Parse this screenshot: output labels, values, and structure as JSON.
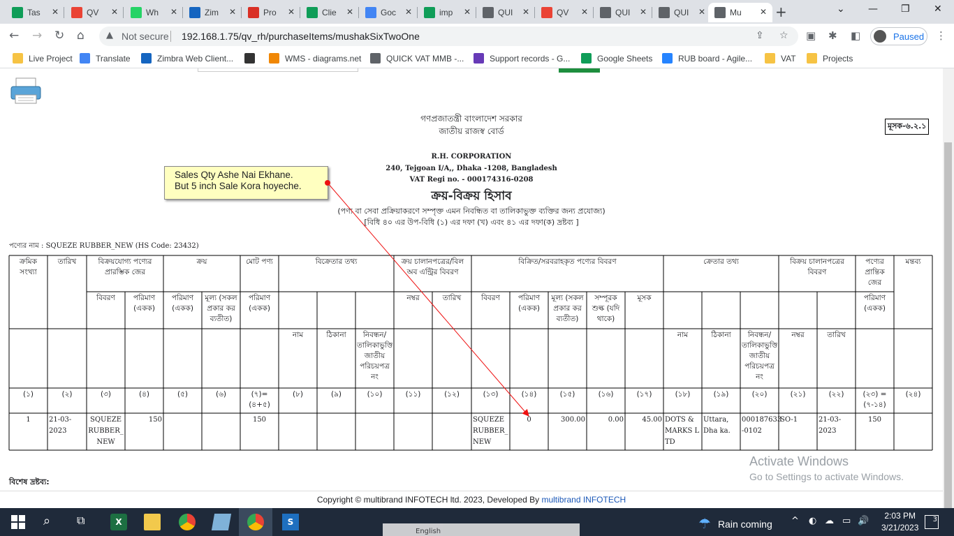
{
  "browser": {
    "tabs": [
      {
        "title": "Tas",
        "icon": "google-sheets-icon",
        "color": "#0f9d58"
      },
      {
        "title": "QV",
        "icon": "chrome-icon",
        "color": "#ea4335"
      },
      {
        "title": "Wh",
        "icon": "whatsapp-icon",
        "color": "#25d366"
      },
      {
        "title": "Zim",
        "icon": "zimbra-icon",
        "color": "#1565c0"
      },
      {
        "title": "Pro",
        "icon": "gmail-icon",
        "color": "#d93025"
      },
      {
        "title": "Clie",
        "icon": "google-sheets-icon",
        "color": "#0f9d58"
      },
      {
        "title": "Goc",
        "icon": "google-calendar-icon",
        "color": "#4285f4"
      },
      {
        "title": "imp",
        "icon": "google-sheets-icon",
        "color": "#0f9d58"
      },
      {
        "title": "QUI",
        "icon": "gear-icon",
        "color": "#5f6368"
      },
      {
        "title": "QV",
        "icon": "chrome-icon",
        "color": "#ea4335"
      },
      {
        "title": "QUI",
        "icon": "gear-icon",
        "color": "#5f6368"
      },
      {
        "title": "QUI",
        "icon": "gear-icon",
        "color": "#5f6368"
      },
      {
        "title": "Mu",
        "icon": "gear-icon",
        "color": "#5f6368",
        "active": true
      }
    ],
    "not_secure": "Not secure",
    "url": "192.168.1.75/qv_rh/purchaseItems/mushakSixTwoOne",
    "profile": "Paused",
    "bookmarks": [
      {
        "label": "Live Project",
        "color": "#f6c344"
      },
      {
        "label": "Translate",
        "color": "#4285f4"
      },
      {
        "label": "Zimbra Web Client...",
        "color": "#1565c0"
      },
      {
        "label": "",
        "color": "#333"
      },
      {
        "label": "WMS - diagrams.net",
        "color": "#f08705"
      },
      {
        "label": "QUICK VAT MMB -...",
        "color": "#5f6368"
      },
      {
        "label": "Support records - G...",
        "color": "#673ab7"
      },
      {
        "label": "Google Sheets",
        "color": "#0f9d58"
      },
      {
        "label": "RUB board - Agile...",
        "color": "#2684ff"
      },
      {
        "label": "VAT",
        "color": "#f6c344"
      },
      {
        "label": "Projects",
        "color": "#f6c344"
      }
    ]
  },
  "report": {
    "govt": "গণপ্রজাতন্ত্রী বাংলাদেশ সরকার",
    "board": "জাতীয় রাজস্ব বোর্ড",
    "form_code": "মূসক-৬.২.১",
    "company": "R.H. CORPORATION",
    "address": "240, Tejgoan I/A,, Dhaka -1208, Bangladesh",
    "vat_reg": "VAT Regi no. - 000174316-0208",
    "title": "ক্রয়-বিক্রয় হিসাব",
    "subtitle": "(পণ্য বা সেবা প্রক্রিয়াকরণে সম্পৃক্ত এমন নিবন্ধিত বা তালিকাভুক্ত ব্যক্তির জন্য প্রযোজ্য)",
    "rule": "[বিধি ৪০ এর উপ-বিধি (১) এর দফা (খ) এবং ৪১ এর দফা(ক) দ্রষ্টব্য ]",
    "product_line": "পণ্যের নাম : SQUEZE RUBBER_NEW (HS Code: 23432)",
    "note_line1": "Sales Qty Ashe Nai Ekhane.",
    "note_line2": "But 5 inch Sale Kora hoyeche.",
    "headers": {
      "serial": "ক্রমিক সংখ্যা",
      "date": "তারিখ",
      "opening": "বিক্রয়যোগ্য পণ্যের প্রারম্ভিক জের",
      "purchase": "ক্রয়",
      "total": "মোট পণ্য",
      "seller_info": "বিক্রেতার তথ্য",
      "purchase_invoice": "ক্রয় চালানপত্রের/বিল অব এন্ট্রির বিবরণ",
      "sold_goods": "বিক্রিত/সরবরাহকৃত পণ্যের বিবরণ",
      "buyer_info": "ক্রেতার তথ্য",
      "sales_invoice": "বিক্রয় চালানপত্রের বিবরণ",
      "closing": "পণ্যের প্রান্তিক জের",
      "remarks": "মন্তব্য",
      "desc": "বিবরণ",
      "qty": "পরিমাণ (একক)",
      "price": "মূল্য (সকল প্রকার কর ব্যতীত)",
      "sd": "সম্পূরক শুল্ক (যদি থাকে)",
      "vat": "মূসক",
      "number": "নম্বর",
      "name": "নাম",
      "address": "ঠিকানা",
      "reg": "নিবন্ধন/ তালিকাভুক্তি জাতীয় পরিচয়পত্র নং"
    },
    "col_numbers": [
      "(১)",
      "(২)",
      "(৩)",
      "(৪)",
      "(৫)",
      "(৬)",
      "(৭)=(৪+৫)",
      "(৮)",
      "(৯)",
      "(১০)",
      "(১১)",
      "(১২)",
      "(১৩)",
      "(১৪)",
      "(১৫)",
      "(১৬)",
      "(১৭)",
      "(১৮)",
      "(১৯)",
      "(২০)",
      "(২১)",
      "(২২)",
      "(২৩) = (৭-১৪)",
      "(২৪)"
    ],
    "row": {
      "serial": "1",
      "date": "21-03-2023",
      "item": "SQUEZE RUBBER_ NEW",
      "opening_qty": "150",
      "total_qty": "150",
      "sold_item": "SQUEZE RUBBER_ NEW",
      "sold_qty": "0",
      "price": "300.00",
      "sd": "0.00",
      "vat": "45.00",
      "buyer": "DOTS & MARKS L TD",
      "buyer_addr": "Uttara, Dha ka.",
      "buyer_reg": "000187633 -0102",
      "invoice": "SO-1",
      "invoice_date": "21-03-2023",
      "closing": "150"
    },
    "special_note": "বিশেষ দ্রষ্টব্য:"
  },
  "watermark_line1": "Activate Windows",
  "watermark_line2": "Go to Settings to activate Windows.",
  "footer_prefix": "Copyright © multibrand INFOTECH ltd. 2023, Developed By ",
  "footer_link": "multibrand INFOTECH",
  "taskbar": {
    "weather": "Rain coming",
    "time": "2:03 PM",
    "date": "3/21/2023",
    "notifications": "3",
    "lang": "English"
  }
}
